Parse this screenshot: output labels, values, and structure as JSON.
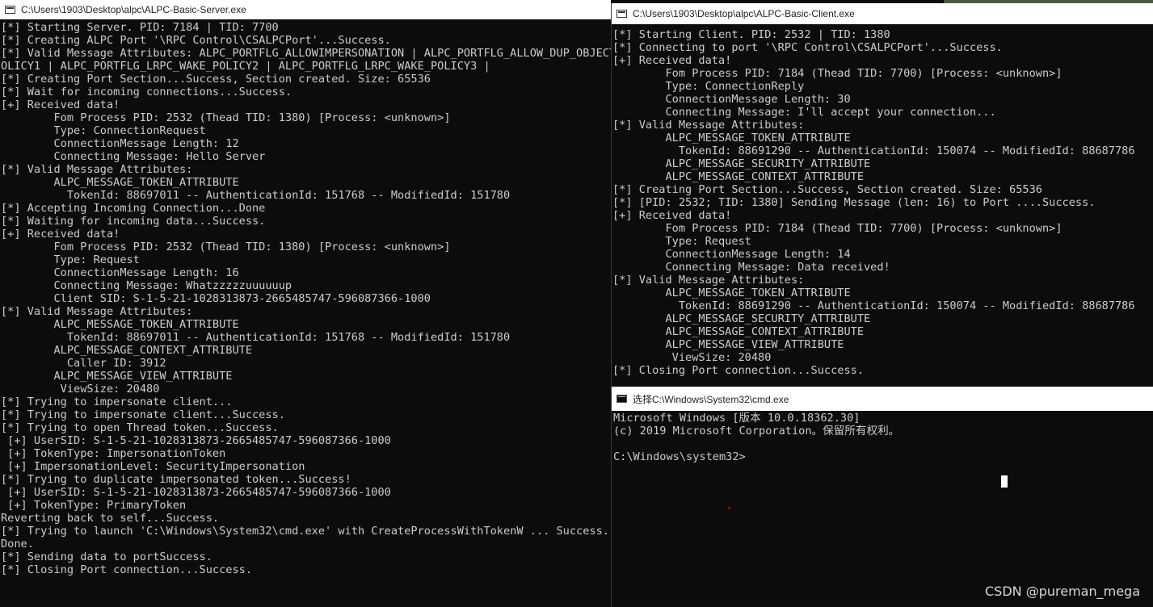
{
  "server": {
    "title": "C:\\Users\\1903\\Desktop\\alpc\\ALPC-Basic-Server.exe",
    "lines": [
      "[*] Starting Server. PID: 7184 | TID: 7700",
      "[*] Creating ALPC Port '\\RPC Control\\CSALPCPort'...Success.",
      "[*] Valid Message Attributes: ALPC_PORTFLG_ALLOWIMPERSONATION | ALPC_PORTFLG_ALLOW_DUP_OBJECT",
      "OLICY1 | ALPC_PORTFLG_LRPC_WAKE_POLICY2 | ALPC_PORTFLG_LRPC_WAKE_POLICY3 |",
      "[*] Creating Port Section...Success, Section created. Size: 65536",
      "[*] Wait for incoming connections...Success.",
      "[+] Received data!",
      "        Fom Process PID: 2532 (Thead TID: 1380) [Process: <unknown>]",
      "        Type: ConnectionRequest",
      "        ConnectionMessage Length: 12",
      "        Connecting Message: Hello Server",
      "[*] Valid Message Attributes:",
      "        ALPC_MESSAGE_TOKEN_ATTRIBUTE",
      "          TokenId: 88697011 -- AuthenticationId: 151768 -- ModifiedId: 151780",
      "[*] Accepting Incoming Connection...Done",
      "[*] Waiting for incoming data...Success.",
      "[+] Received data!",
      "        Fom Process PID: 2532 (Thead TID: 1380) [Process: <unknown>]",
      "        Type: Request",
      "        ConnectionMessage Length: 16",
      "        Connecting Message: Whatzzzzzuuuuuup",
      "        Client SID: S-1-5-21-1028313873-2665485747-596087366-1000",
      "[*] Valid Message Attributes:",
      "        ALPC_MESSAGE_TOKEN_ATTRIBUTE",
      "          TokenId: 88697011 -- AuthenticationId: 151768 -- ModifiedId: 151780",
      "        ALPC_MESSAGE_CONTEXT_ATTRIBUTE",
      "          Caller ID: 3912",
      "        ALPC_MESSAGE_VIEW_ATTRIBUTE",
      "         ViewSize: 20480",
      "[*] Trying to impersonate client...",
      "[*] Trying to impersonate client...Success.",
      "[*] Trying to open Thread token...Success.",
      " [+] UserSID: S-1-5-21-1028313873-2665485747-596087366-1000",
      " [+] TokenType: ImpersonationToken",
      " [+] ImpersonationLevel: SecurityImpersonation",
      "[*] Trying to duplicate impersonated token...Success!",
      " [+] UserSID: S-1-5-21-1028313873-2665485747-596087366-1000",
      " [+] TokenType: PrimaryToken",
      "Reverting back to self...Success.",
      "[*] Trying to launch 'C:\\Windows\\System32\\cmd.exe' with CreateProcessWithTokenW ... Success.",
      "Done.",
      "[*] Sending data to portSuccess.",
      "[*] Closing Port connection...Success."
    ]
  },
  "client": {
    "title": "C:\\Users\\1903\\Desktop\\alpc\\ALPC-Basic-Client.exe",
    "lines": [
      "[*] Starting Client. PID: 2532 | TID: 1380",
      "[*] Connecting to port '\\RPC Control\\CSALPCPort'...Success.",
      "[+] Received data!",
      "        Fom Process PID: 7184 (Thead TID: 7700) [Process: <unknown>]",
      "        Type: ConnectionReply",
      "        ConnectionMessage Length: 30",
      "        Connecting Message: I'll accept your connection...",
      "[*] Valid Message Attributes:",
      "        ALPC_MESSAGE_TOKEN_ATTRIBUTE",
      "          TokenId: 88691290 -- AuthenticationId: 150074 -- ModifiedId: 88687786",
      "        ALPC_MESSAGE_SECURITY_ATTRIBUTE",
      "        ALPC_MESSAGE_CONTEXT_ATTRIBUTE",
      "[*] Creating Port Section...Success, Section created. Size: 65536",
      "[*] [PID: 2532; TID: 1380] Sending Message (len: 16) to Port ....Success.",
      "[+] Received data!",
      "        Fom Process PID: 7184 (Thead TID: 7700) [Process: <unknown>]",
      "        Type: Request",
      "        ConnectionMessage Length: 14",
      "        Connecting Message: Data received!",
      "[*] Valid Message Attributes:",
      "        ALPC_MESSAGE_TOKEN_ATTRIBUTE",
      "          TokenId: 88691290 -- AuthenticationId: 150074 -- ModifiedId: 88687786",
      "        ALPC_MESSAGE_SECURITY_ATTRIBUTE",
      "        ALPC_MESSAGE_CONTEXT_ATTRIBUTE",
      "        ALPC_MESSAGE_VIEW_ATTRIBUTE",
      "         ViewSize: 20480",
      "[*] Closing Port connection...Success."
    ]
  },
  "cmd": {
    "title": "选择C:\\Windows\\System32\\cmd.exe",
    "lines": [
      "Microsoft Windows [版本 10.0.18362.30]",
      "(c) 2019 Microsoft Corporation。保留所有权利。",
      "",
      "C:\\Windows\\system32>"
    ]
  },
  "watermark": "CSDN @pureman_mega",
  "colors": {
    "console_bg": "#0c0c0c",
    "console_text": "#cccccc",
    "titlebar_bg": "#ffffff"
  }
}
